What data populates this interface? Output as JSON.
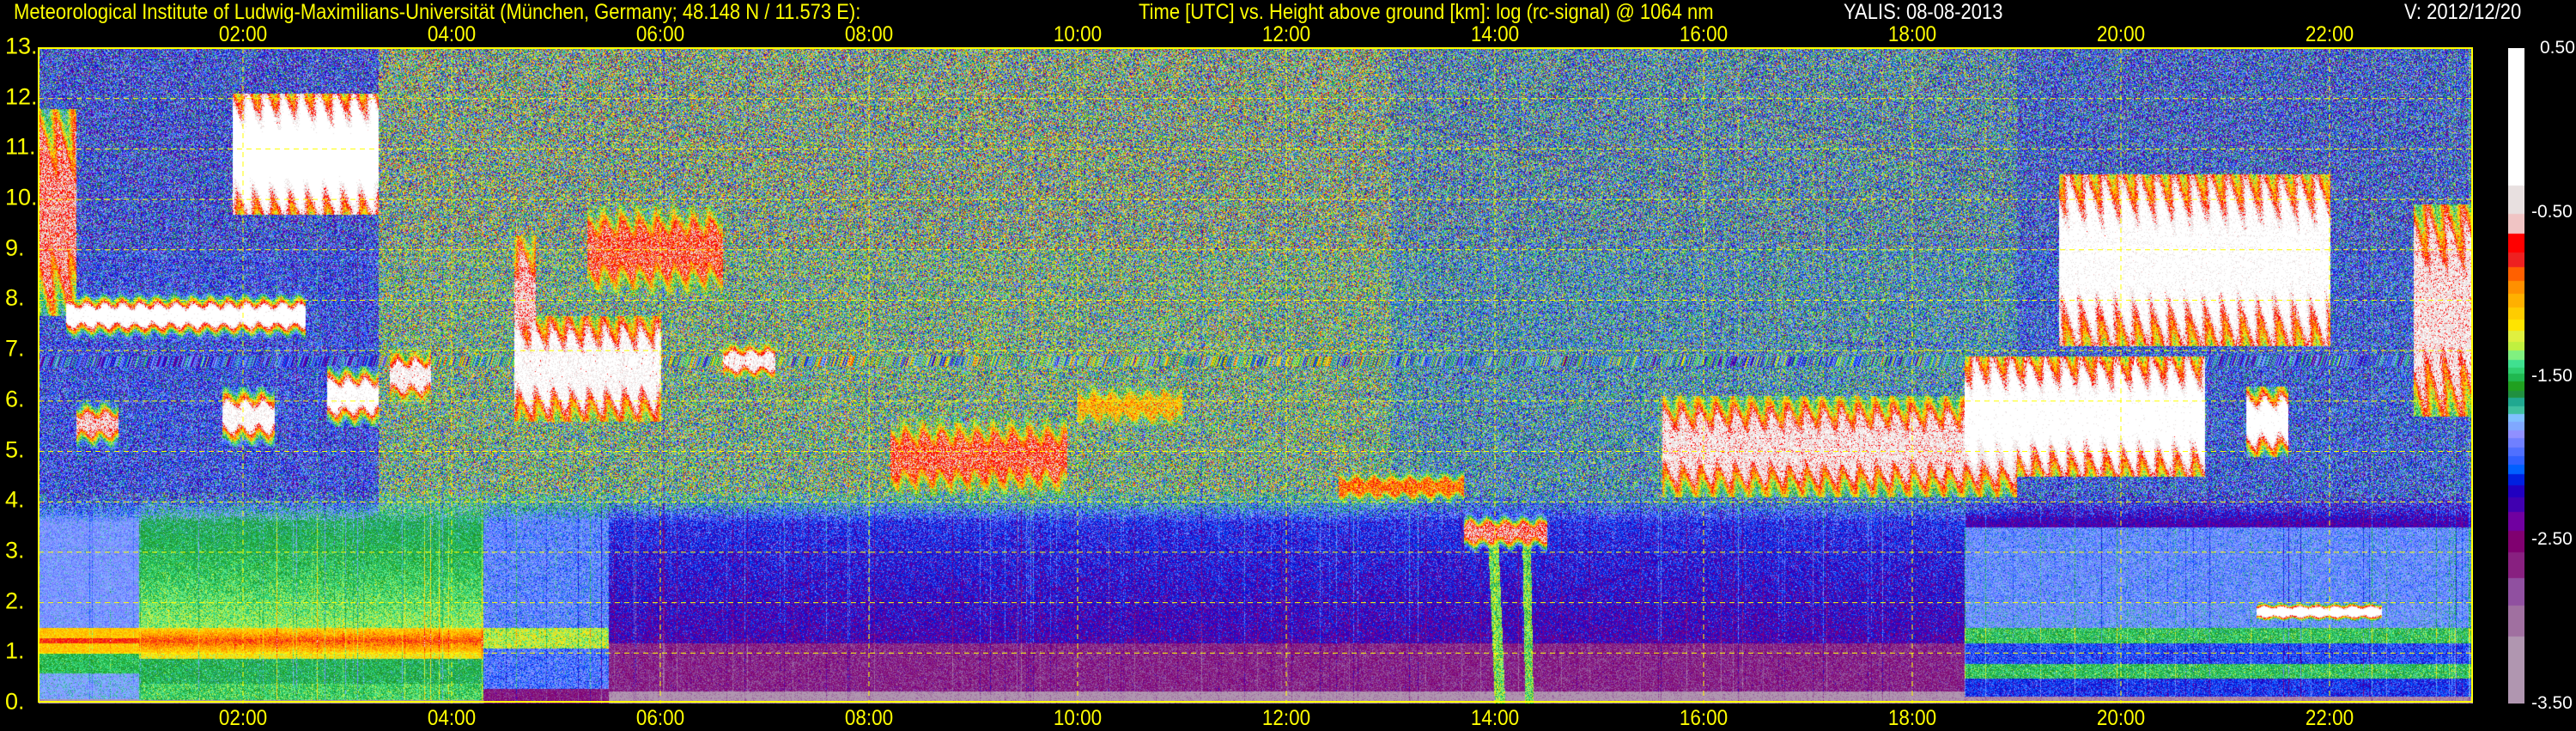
{
  "header": {
    "institute": "Meteorological Institute of Ludwig-Maximilians-Universität (München, Germany; 48.148 N / 11.573 E):",
    "plot_description": "Time [UTC] vs. Height above ground [km]: log (rc-signal) @ 1064 nm",
    "instrument_date": "YALIS: 08-08-2013",
    "version": "V: 2012/12/20"
  },
  "chart_data": {
    "type": "heatmap",
    "title": "Time [UTC] vs. Height above ground [km]: log (rc-signal) @ 1064 nm",
    "xlabel": "Time [UTC]",
    "ylabel": "Height above ground [km]",
    "xlim_hours": [
      0.05,
      23.35
    ],
    "ylim": [
      0,
      13
    ],
    "x_ticks": [
      "02:00",
      "04:00",
      "06:00",
      "08:00",
      "10:00",
      "12:00",
      "14:00",
      "16:00",
      "18:00",
      "20:00",
      "22:00"
    ],
    "x_tick_hours": [
      2,
      4,
      6,
      8,
      10,
      12,
      14,
      16,
      18,
      20,
      22
    ],
    "y_ticks": [
      "0.",
      "1.",
      "2.",
      "3.",
      "4.",
      "5.",
      "6.",
      "7.",
      "8.",
      "9.",
      "10.",
      "11.",
      "12.",
      "13."
    ],
    "y_tick_values": [
      0,
      1,
      2,
      3,
      4,
      5,
      6,
      7,
      8,
      9,
      10,
      11,
      12,
      13
    ],
    "grid": true,
    "colorbar": {
      "range": [
        -3.5,
        0.5
      ],
      "tick_labels": [
        "0.50",
        "-0.50",
        "-1.50",
        "-2.50",
        "-3.50"
      ],
      "tick_values": [
        0.5,
        -0.5,
        -1.5,
        -2.5,
        -3.5
      ],
      "stops": [
        {
          "from": -0.335,
          "color": "#ffffff"
        },
        {
          "from": -0.51,
          "color": "#e8e0e0"
        },
        {
          "from": -0.629,
          "color": "#f0c4c4"
        },
        {
          "from": -0.744,
          "color": "#ff0000"
        },
        {
          "from": -0.833,
          "color": "#ee2020"
        },
        {
          "from": -0.92,
          "color": "#ff6000"
        },
        {
          "from": -0.997,
          "color": "#ff9000"
        },
        {
          "from": -1.078,
          "color": "#ffb000"
        },
        {
          "from": -1.154,
          "color": "#ffcc00"
        },
        {
          "from": -1.222,
          "color": "#ffe400"
        },
        {
          "from": -1.288,
          "color": "#e0f040"
        },
        {
          "from": -1.345,
          "color": "#c0f040"
        },
        {
          "from": -1.399,
          "color": "#80f080"
        },
        {
          "from": -1.446,
          "color": "#40e090"
        },
        {
          "from": -1.486,
          "color": "#30d070"
        },
        {
          "from": -1.533,
          "color": "#20b850"
        },
        {
          "from": -1.587,
          "color": "#20a020"
        },
        {
          "from": -1.631,
          "color": "#209040"
        },
        {
          "from": -1.685,
          "color": "#20a890"
        },
        {
          "from": -1.731,
          "color": "#40c0a0"
        },
        {
          "from": -1.778,
          "color": "#80c0ff"
        },
        {
          "from": -1.832,
          "color": "#80a8ff"
        },
        {
          "from": -1.878,
          "color": "#9090ff"
        },
        {
          "from": -1.933,
          "color": "#7080ff"
        },
        {
          "from": -1.987,
          "color": "#5070ff"
        },
        {
          "from": -2.041,
          "color": "#3060ff"
        },
        {
          "from": -2.096,
          "color": "#0060ff"
        },
        {
          "from": -2.167,
          "color": "#0020e0"
        },
        {
          "from": -2.24,
          "color": "#2000c0"
        },
        {
          "from": -2.33,
          "color": "#4000b0"
        },
        {
          "from": -2.444,
          "color": "#7000a0"
        },
        {
          "from": -2.575,
          "color": "#800070"
        },
        {
          "from": -2.733,
          "color": "#882080"
        },
        {
          "from": -2.901,
          "color": "#9050a0"
        },
        {
          "from": -3.086,
          "color": "#a070a0"
        },
        {
          "from": -3.5,
          "color": "#b096b0"
        }
      ]
    },
    "features": {
      "clouds": [
        {
          "t0": 1.9,
          "t1": 3.3,
          "h0": 10.0,
          "h1": 11.8,
          "v": 0.2
        },
        {
          "t0": 0.0,
          "t1": 0.4,
          "h0": 8.0,
          "h1": 11.5,
          "v": -0.6
        },
        {
          "t0": 0.3,
          "t1": 2.6,
          "h0": 7.5,
          "h1": 7.9,
          "v": 0.0
        },
        {
          "t0": 0.4,
          "t1": 0.8,
          "h0": 5.3,
          "h1": 5.8,
          "v": -0.5
        },
        {
          "t0": 1.8,
          "t1": 2.3,
          "h0": 5.4,
          "h1": 6.0,
          "v": -0.2
        },
        {
          "t0": 2.8,
          "t1": 3.3,
          "h0": 5.8,
          "h1": 6.4,
          "v": -0.1
        },
        {
          "t0": 3.4,
          "t1": 3.8,
          "h0": 6.2,
          "h1": 6.8,
          "v": -0.3
        },
        {
          "t0": 4.6,
          "t1": 6.0,
          "h0": 5.9,
          "h1": 7.4,
          "v": -0.2
        },
        {
          "t0": 4.6,
          "t1": 4.8,
          "h0": 7.0,
          "h1": 9.0,
          "v": -0.5
        },
        {
          "t0": 5.3,
          "t1": 6.6,
          "h0": 8.4,
          "h1": 9.6,
          "v": -0.7
        },
        {
          "t0": 6.6,
          "t1": 7.1,
          "h0": 6.6,
          "h1": 7.0,
          "v": -0.3
        },
        {
          "t0": 8.2,
          "t1": 9.9,
          "h0": 4.4,
          "h1": 5.4,
          "v": -0.7
        },
        {
          "t0": 10.0,
          "t1": 11.0,
          "h0": 5.6,
          "h1": 6.2,
          "v": -1.1
        },
        {
          "t0": 12.5,
          "t1": 13.7,
          "h0": 4.1,
          "h1": 4.5,
          "v": -0.9
        },
        {
          "t0": 13.7,
          "t1": 14.5,
          "h0": 3.2,
          "h1": 3.6,
          "v": -0.6
        },
        {
          "t0": 15.6,
          "t1": 19.0,
          "h0": 4.4,
          "h1": 5.8,
          "v": -0.4
        },
        {
          "t0": 18.5,
          "t1": 20.8,
          "h0": 4.8,
          "h1": 6.6,
          "v": 0.0
        },
        {
          "t0": 19.4,
          "t1": 22.0,
          "h0": 7.4,
          "h1": 10.2,
          "v": -0.1
        },
        {
          "t0": 21.2,
          "t1": 21.6,
          "h0": 5.2,
          "h1": 6.0,
          "v": 0.0
        },
        {
          "t0": 22.8,
          "t1": 23.4,
          "h0": 6.0,
          "h1": 9.6,
          "v": -0.4
        },
        {
          "t0": 21.3,
          "t1": 22.5,
          "h0": 1.75,
          "h1": 1.9,
          "v": 0.3
        }
      ]
    }
  }
}
